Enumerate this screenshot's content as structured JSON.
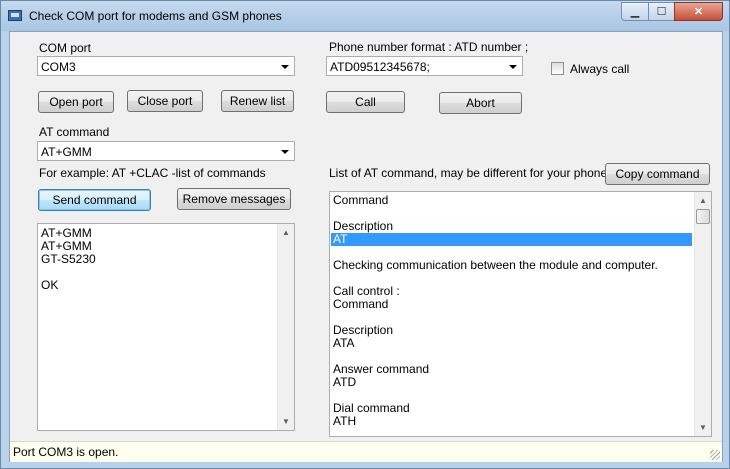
{
  "window": {
    "title": "Check COM port for modems and GSM phones",
    "min_glyph": "▁",
    "max_glyph": "☐",
    "close_glyph": "✕"
  },
  "com_port": {
    "label": "COM port",
    "value": "COM3"
  },
  "phone": {
    "label": "Phone number format : ATD number ;",
    "value": "ATD09512345678;",
    "always_call_label": "Always call"
  },
  "buttons": {
    "open_port": "Open port",
    "close_port": "Close port",
    "renew_list": "Renew list",
    "call": "Call",
    "abort": "Abort",
    "send_command": "Send command",
    "remove_messages": "Remove messages",
    "copy_command": "Copy command"
  },
  "at_command": {
    "label": "AT command",
    "value": "AT+GMM",
    "example": "For example: AT +CLAC -list of commands"
  },
  "output_lines": [
    "AT+GMM",
    "AT+GMM",
    "GT-S5230",
    "",
    "OK"
  ],
  "command_list": {
    "label": "List of AT command, may be different for your phone",
    "items": [
      "Command",
      "",
      "Description",
      "AT",
      "",
      "Checking communication between the module and computer.",
      "",
      "Call control :",
      "Command",
      "",
      "Description",
      "ATA",
      "",
      "Answer command",
      "ATD",
      "",
      "Dial command",
      "ATH"
    ],
    "selected_index": 3
  },
  "status": {
    "text": "Port COM3 is open."
  },
  "scroll_glyphs": {
    "up": "▲",
    "down": "▼"
  }
}
